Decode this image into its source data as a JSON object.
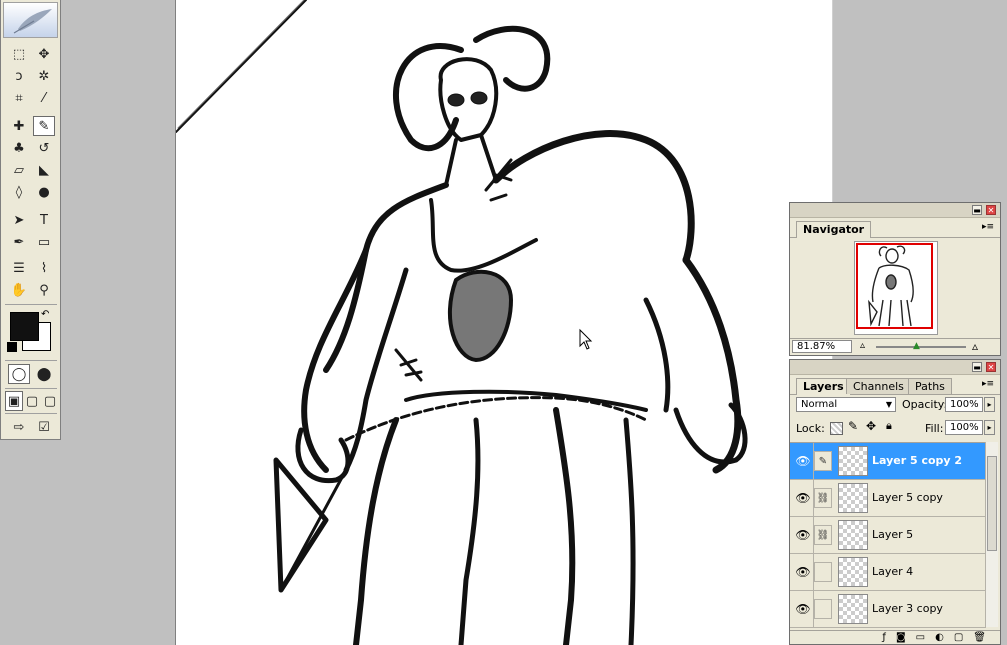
{
  "toolbox": {
    "tools": [
      {
        "icon": "marquee-icon",
        "glyph": "⬚"
      },
      {
        "icon": "move-icon",
        "glyph": "✥"
      },
      {
        "icon": "lasso-icon",
        "glyph": "ↄ"
      },
      {
        "icon": "magic-wand-icon",
        "glyph": "✲"
      },
      {
        "icon": "crop-icon",
        "glyph": "⌗"
      },
      {
        "icon": "slice-icon",
        "glyph": "⁄"
      },
      {
        "icon": "healing-brush-icon",
        "glyph": "✚"
      },
      {
        "icon": "brush-icon",
        "glyph": "✎"
      },
      {
        "icon": "clone-stamp-icon",
        "glyph": "♣"
      },
      {
        "icon": "history-brush-icon",
        "glyph": "↺"
      },
      {
        "icon": "eraser-icon",
        "glyph": "▱"
      },
      {
        "icon": "paint-bucket-icon",
        "glyph": "◣"
      },
      {
        "icon": "blur-icon",
        "glyph": "◊"
      },
      {
        "icon": "dodge-icon",
        "glyph": "●"
      },
      {
        "icon": "path-selection-icon",
        "glyph": "➤"
      },
      {
        "icon": "type-icon",
        "glyph": "T"
      },
      {
        "icon": "pen-icon",
        "glyph": "✒"
      },
      {
        "icon": "rectangle-shape-icon",
        "glyph": "▭"
      },
      {
        "icon": "notes-icon",
        "glyph": "☰"
      },
      {
        "icon": "eyedropper-icon",
        "glyph": "⌇"
      },
      {
        "icon": "hand-icon",
        "glyph": "✋"
      },
      {
        "icon": "zoom-icon",
        "glyph": "⚲"
      }
    ],
    "foreground_color": "#111111",
    "background_color": "#ffffff"
  },
  "navigator": {
    "tab_label": "Navigator",
    "zoom": "81.87%"
  },
  "layers": {
    "tabs": [
      "Layers",
      "Channels",
      "Paths"
    ],
    "blend_mode": "Normal",
    "opacity_label": "Opacity:",
    "opacity": "100%",
    "lock_label": "Lock:",
    "fill_label": "Fill:",
    "fill": "100%",
    "items": [
      {
        "name": "Layer 5 copy 2",
        "link": "brush"
      },
      {
        "name": "Layer 5 copy",
        "link": "chain"
      },
      {
        "name": "Layer 5",
        "link": "chain"
      },
      {
        "name": "Layer 4",
        "link": ""
      },
      {
        "name": "Layer 3 copy",
        "link": ""
      }
    ]
  },
  "colors": {
    "selection": "#3399ff",
    "panel": "#ece9d8"
  }
}
